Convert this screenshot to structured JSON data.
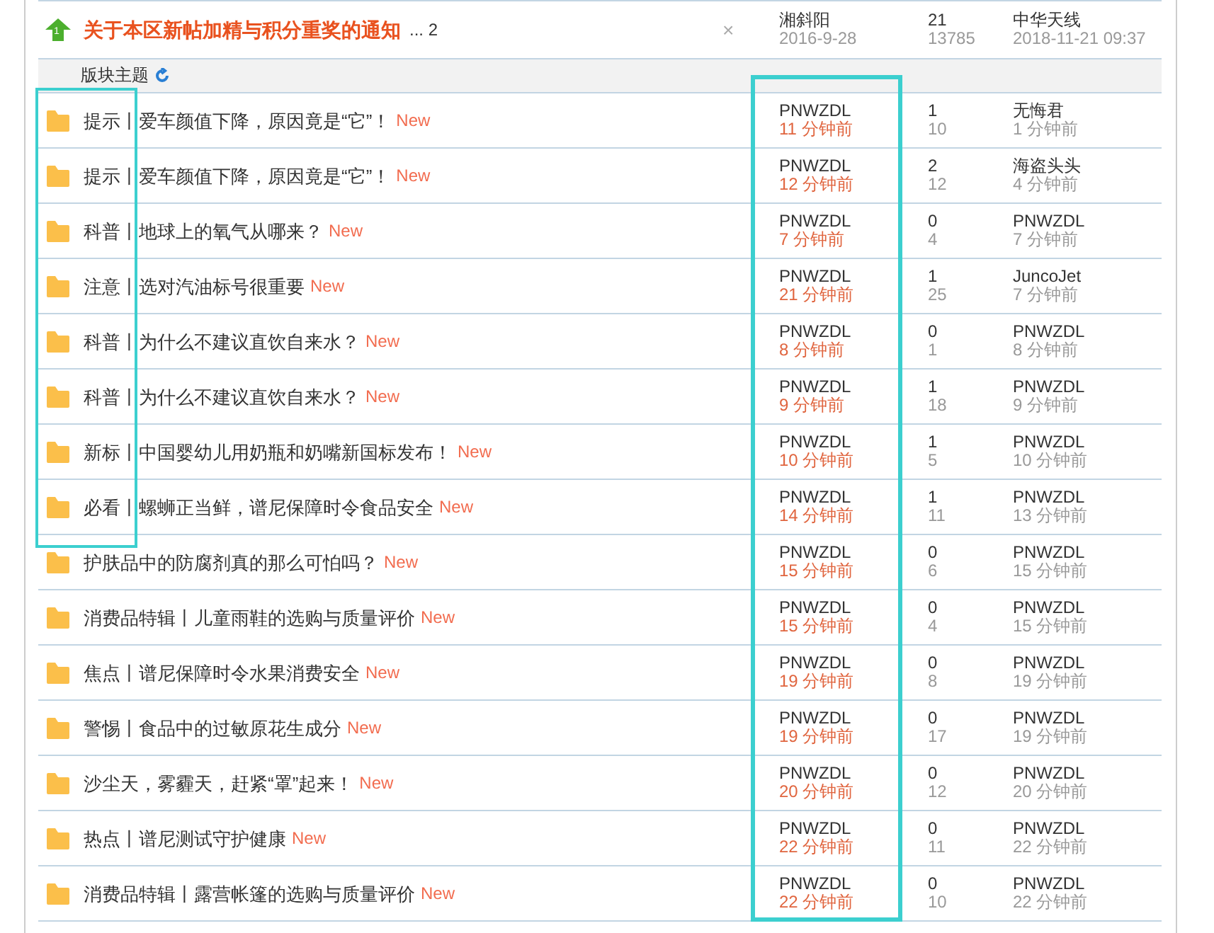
{
  "sticky": {
    "icon_number": "1",
    "title": "关于本区新帖加精与积分重奖的通知",
    "pages": "... 2",
    "close": "×",
    "author": "湘斜阳",
    "date": "2016-9-28",
    "replies": "21",
    "views": "13785",
    "last_poster": "中华天线",
    "last_time": "2018-11-21 09:37"
  },
  "section_header": {
    "label": "版块主题"
  },
  "threads": [
    {
      "title": "提示丨爱车颜值下降，原因竟是“它”！",
      "badge": "New",
      "author": "PNWZDL",
      "time": "11 分钟前",
      "replies": "1",
      "views": "10",
      "last_poster": "无悔君",
      "last_time": "1 分钟前"
    },
    {
      "title": "提示丨爱车颜值下降，原因竟是“它”！",
      "badge": "New",
      "author": "PNWZDL",
      "time": "12 分钟前",
      "replies": "2",
      "views": "12",
      "last_poster": "海盗头头",
      "last_time": "4 分钟前"
    },
    {
      "title": "科普丨地球上的氧气从哪来？",
      "badge": "New",
      "author": "PNWZDL",
      "time": "7 分钟前",
      "replies": "0",
      "views": "4",
      "last_poster": "PNWZDL",
      "last_time": "7 分钟前"
    },
    {
      "title": "注意丨选对汽油标号很重要",
      "badge": "New",
      "author": "PNWZDL",
      "time": "21 分钟前",
      "replies": "1",
      "views": "25",
      "last_poster": "JuncoJet",
      "last_time": "7 分钟前"
    },
    {
      "title": "科普丨为什么不建议直饮自来水？",
      "badge": "New",
      "author": "PNWZDL",
      "time": "8 分钟前",
      "replies": "0",
      "views": "1",
      "last_poster": "PNWZDL",
      "last_time": "8 分钟前"
    },
    {
      "title": "科普丨为什么不建议直饮自来水？",
      "badge": "New",
      "author": "PNWZDL",
      "time": "9 分钟前",
      "replies": "1",
      "views": "18",
      "last_poster": "PNWZDL",
      "last_time": "9 分钟前"
    },
    {
      "title": "新标丨中国婴幼儿用奶瓶和奶嘴新国标发布！",
      "badge": "New",
      "author": "PNWZDL",
      "time": "10 分钟前",
      "replies": "1",
      "views": "5",
      "last_poster": "PNWZDL",
      "last_time": "10 分钟前"
    },
    {
      "title": "必看丨螺蛳正当鲜，谱尼保障时令食品安全",
      "badge": "New",
      "author": "PNWZDL",
      "time": "14 分钟前",
      "replies": "1",
      "views": "11",
      "last_poster": "PNWZDL",
      "last_time": "13 分钟前"
    },
    {
      "title": "护肤品中的防腐剂真的那么可怕吗？",
      "badge": "New",
      "author": "PNWZDL",
      "time": "15 分钟前",
      "replies": "0",
      "views": "6",
      "last_poster": "PNWZDL",
      "last_time": "15 分钟前"
    },
    {
      "title": "消费品特辑丨儿童雨鞋的选购与质量评价",
      "badge": "New",
      "author": "PNWZDL",
      "time": "15 分钟前",
      "replies": "0",
      "views": "4",
      "last_poster": "PNWZDL",
      "last_time": "15 分钟前"
    },
    {
      "title": "焦点丨谱尼保障时令水果消费安全",
      "badge": "New",
      "author": "PNWZDL",
      "time": "19 分钟前",
      "replies": "0",
      "views": "8",
      "last_poster": "PNWZDL",
      "last_time": "19 分钟前"
    },
    {
      "title": "警惕丨食品中的过敏原花生成分",
      "badge": "New",
      "author": "PNWZDL",
      "time": "19 分钟前",
      "replies": "0",
      "views": "17",
      "last_poster": "PNWZDL",
      "last_time": "19 分钟前"
    },
    {
      "title": "沙尘天，雾霾天，赶紧“罩”起来！",
      "badge": "New",
      "author": "PNWZDL",
      "time": "20 分钟前",
      "replies": "0",
      "views": "12",
      "last_poster": "PNWZDL",
      "last_time": "20 分钟前"
    },
    {
      "title": "热点丨谱尼测试守护健康",
      "badge": "New",
      "author": "PNWZDL",
      "time": "22 分钟前",
      "replies": "0",
      "views": "11",
      "last_poster": "PNWZDL",
      "last_time": "22 分钟前"
    },
    {
      "title": "消费品特辑丨露营帐篷的选购与质量评价",
      "badge": "New",
      "author": "PNWZDL",
      "time": "22 分钟前",
      "replies": "0",
      "views": "10",
      "last_poster": "PNWZDL",
      "last_time": "22 分钟前"
    }
  ]
}
